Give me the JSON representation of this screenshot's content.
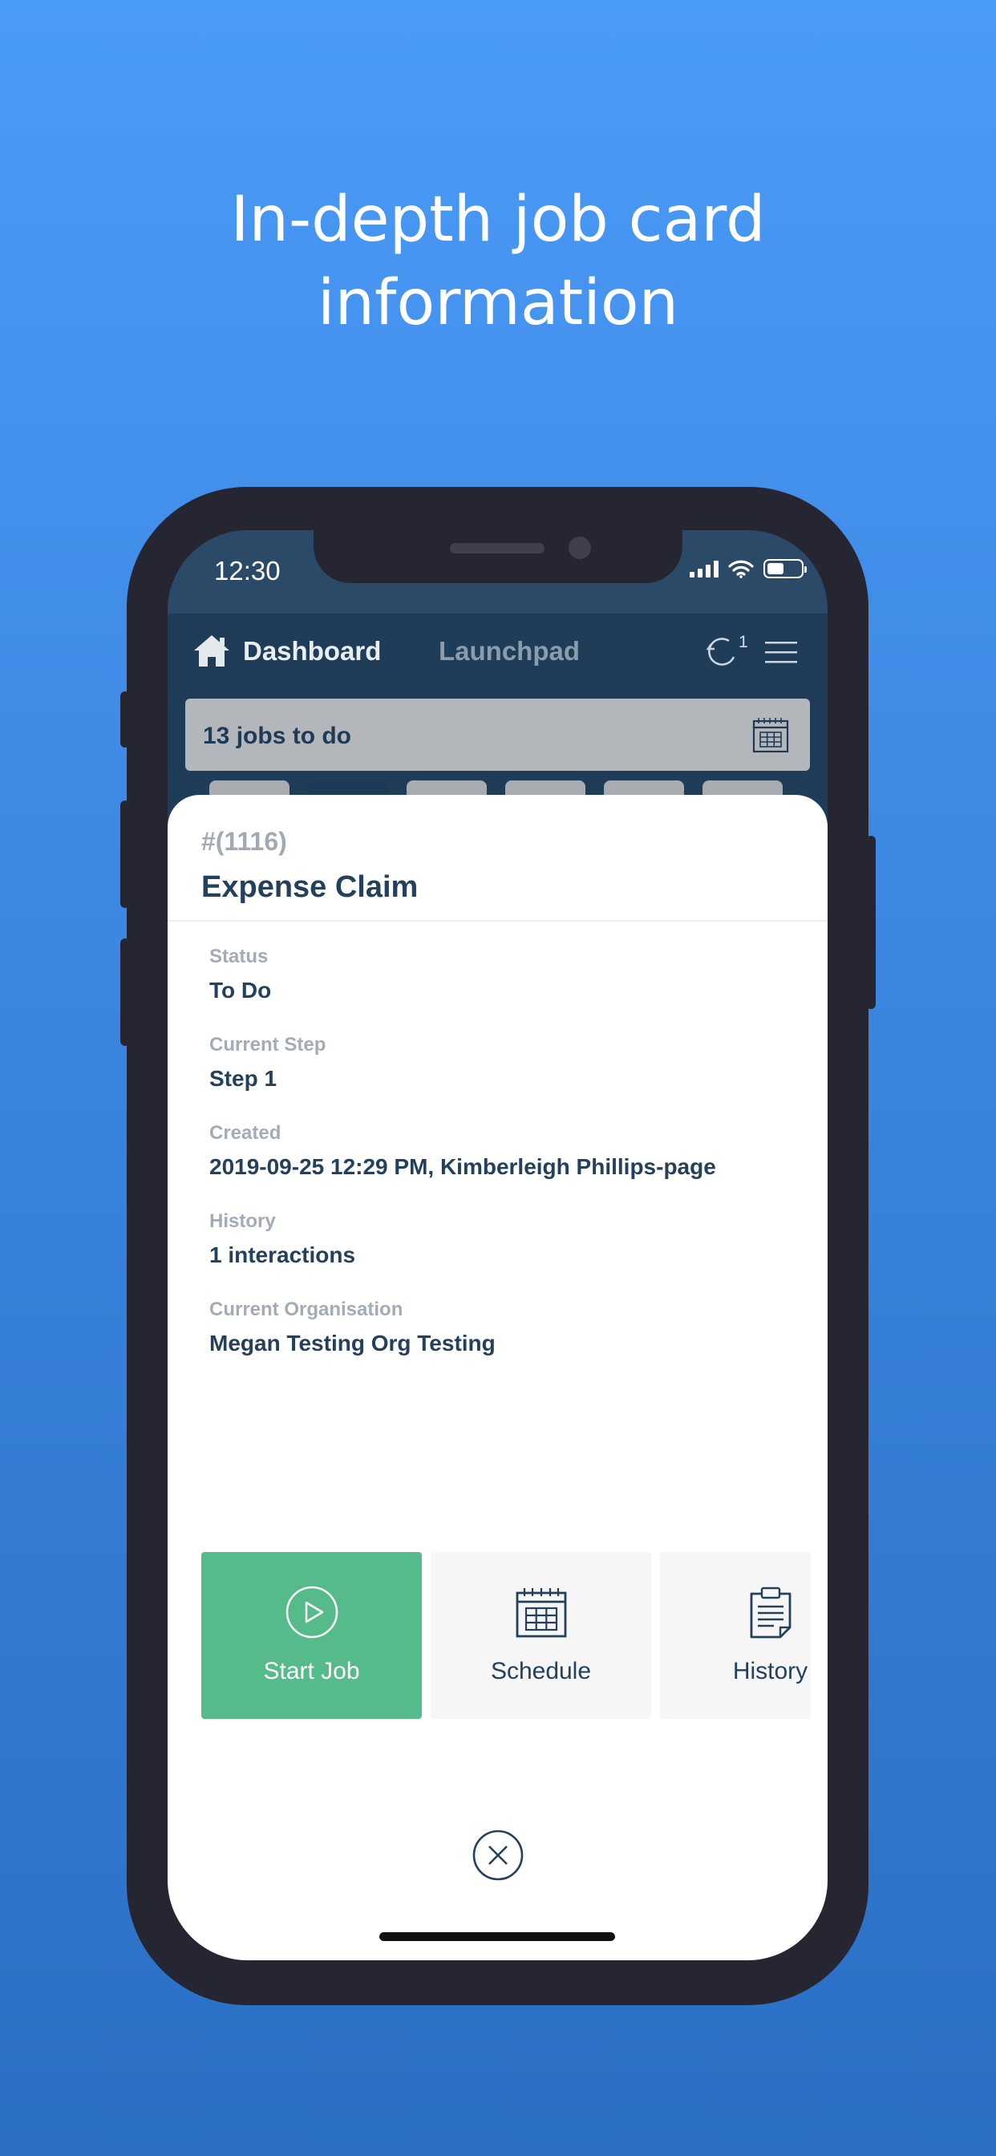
{
  "headline": {
    "line1": "In-depth job card",
    "line2": "information"
  },
  "status_bar": {
    "time": "12:30"
  },
  "nav": {
    "dashboard_label": "Dashboard",
    "launchpad_label": "Launchpad",
    "sync_count": "1"
  },
  "jobs_bar": {
    "text": "13 jobs to do"
  },
  "job": {
    "number": "#(1116)",
    "title": "Expense Claim",
    "fields": [
      {
        "label": "Status",
        "value": "To Do"
      },
      {
        "label": "Current Step",
        "value": "Step 1"
      },
      {
        "label": "Created",
        "value": "2019-09-25 12:29 PM, Kimberleigh Phillips-page"
      },
      {
        "label": "History",
        "value": "1 interactions"
      },
      {
        "label": "Current Organisation",
        "value": "Megan Testing Org Testing"
      }
    ]
  },
  "actions": {
    "start": "Start Job",
    "schedule": "Schedule",
    "history": "History"
  },
  "icons": [
    "home-icon",
    "sync-icon",
    "menu-icon",
    "calendar-icon",
    "play-icon",
    "clipboard-icon",
    "close-icon"
  ],
  "colors": {
    "background": "#4a9af7",
    "accent_green": "#55bb8a",
    "navy": "#23405d",
    "nav_bar": "#1f3d59"
  }
}
